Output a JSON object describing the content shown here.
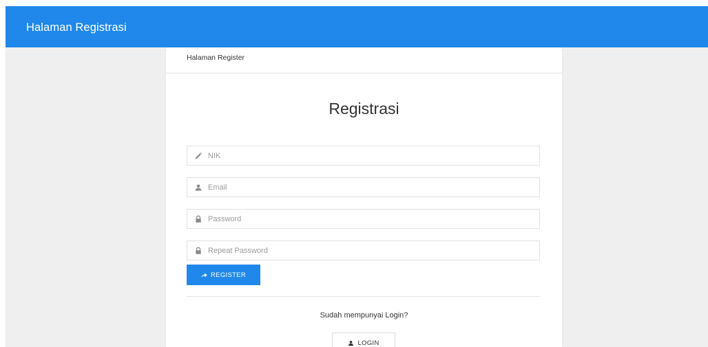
{
  "app": {
    "title": "Halaman Registrasi"
  },
  "card": {
    "breadcrumb": "Halaman Register",
    "heading": "Registrasi"
  },
  "form": {
    "fields": [
      {
        "placeholder": "NIK",
        "value": "",
        "icon": "pencil-icon"
      },
      {
        "placeholder": "Email",
        "value": "",
        "icon": "user-icon"
      },
      {
        "placeholder": "Password",
        "value": "",
        "icon": "lock-icon"
      },
      {
        "placeholder": "Repeat Password",
        "value": "",
        "icon": "lock-icon"
      }
    ],
    "register_label": "REGISTER",
    "register_icon": "share-arrow-icon"
  },
  "footer": {
    "login_prompt": "Sudah mempunyai Login?",
    "login_label": "LOGIN",
    "login_icon": "user-icon"
  },
  "colors": {
    "primary": "#1f88ea",
    "background": "#efefef",
    "card": "#ffffff"
  }
}
